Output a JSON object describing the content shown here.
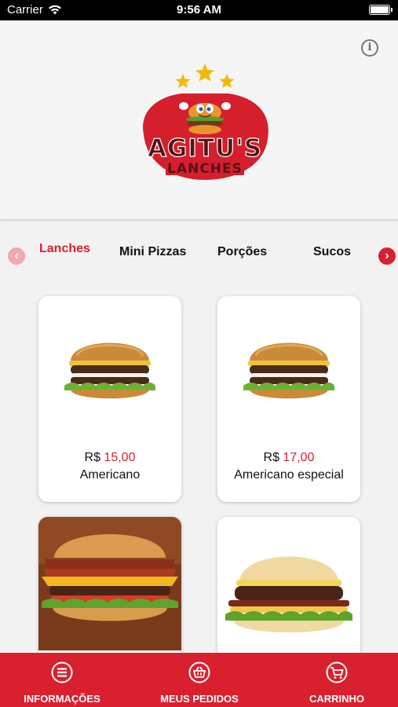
{
  "status_bar": {
    "carrier": "Carrier",
    "time": "9:56 AM"
  },
  "header": {
    "logo": {
      "brand": "AGITU'S",
      "subtitle": "LANCHES"
    },
    "info_icon": "info-icon"
  },
  "categories": {
    "tabs": [
      {
        "label": "Lanches",
        "active": true
      },
      {
        "label": "Mini Pizzas",
        "active": false
      },
      {
        "label": "Porções",
        "active": false
      },
      {
        "label": "Sucos",
        "active": false
      }
    ],
    "prev_icon": "chevron-left-icon",
    "next_icon": "chevron-right-icon"
  },
  "products": [
    {
      "currency": "R$",
      "price": "15,00",
      "name": "Americano"
    },
    {
      "currency": "R$",
      "price": "17,00",
      "name": "Americano especial"
    },
    {
      "currency": "",
      "price": "",
      "name": ""
    },
    {
      "currency": "",
      "price": "",
      "name": ""
    }
  ],
  "bottom_nav": {
    "items": [
      {
        "label": "INFORMAÇÕES",
        "icon": "menu-icon"
      },
      {
        "label": "MEUS PEDIDOS",
        "icon": "basket-icon"
      },
      {
        "label": "CARRINHO",
        "icon": "cart-icon"
      }
    ]
  },
  "colors": {
    "accent": "#d9202e",
    "background": "#f2f2f2"
  }
}
